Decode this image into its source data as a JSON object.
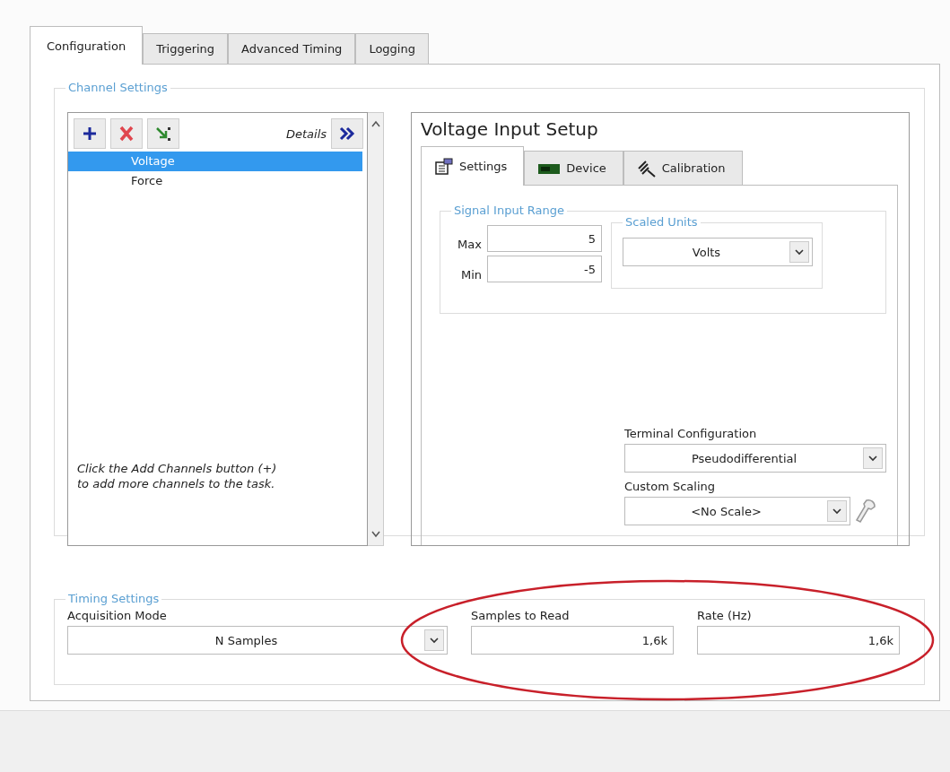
{
  "tabs": [
    {
      "label": "Configuration",
      "selected": true
    },
    {
      "label": "Triggering",
      "selected": false
    },
    {
      "label": "Advanced Timing",
      "selected": false
    },
    {
      "label": "Logging",
      "selected": false
    }
  ],
  "channel_settings": {
    "title": "Channel Settings",
    "details_label": "Details",
    "channels": [
      {
        "name": "Voltage",
        "selected": true
      },
      {
        "name": "Force",
        "selected": false
      }
    ],
    "hint": "Click the Add Channels button (+) to add more channels to the task."
  },
  "setup": {
    "title": "Voltage Input Setup",
    "tabs": [
      {
        "label": "Settings",
        "kind": "settings",
        "selected": true
      },
      {
        "label": "Device",
        "kind": "device",
        "selected": false
      },
      {
        "label": "Calibration",
        "kind": "calibration",
        "selected": false
      }
    ],
    "signal_input_range": {
      "title": "Signal Input Range",
      "max_label": "Max",
      "max_value": "5",
      "min_label": "Min",
      "min_value": "-5"
    },
    "scaled_units": {
      "title": "Scaled Units",
      "value": "Volts"
    },
    "terminal_configuration": {
      "label": "Terminal Configuration",
      "value": "Pseudodifferential"
    },
    "custom_scaling": {
      "label": "Custom Scaling",
      "value": "<No Scale>"
    }
  },
  "timing_settings": {
    "title": "Timing Settings",
    "acquisition_mode": {
      "label": "Acquisition Mode",
      "value": "N Samples"
    },
    "samples_to_read": {
      "label": "Samples to Read",
      "value": "1,6k"
    },
    "rate": {
      "label": "Rate (Hz)",
      "value": "1,6k"
    }
  }
}
